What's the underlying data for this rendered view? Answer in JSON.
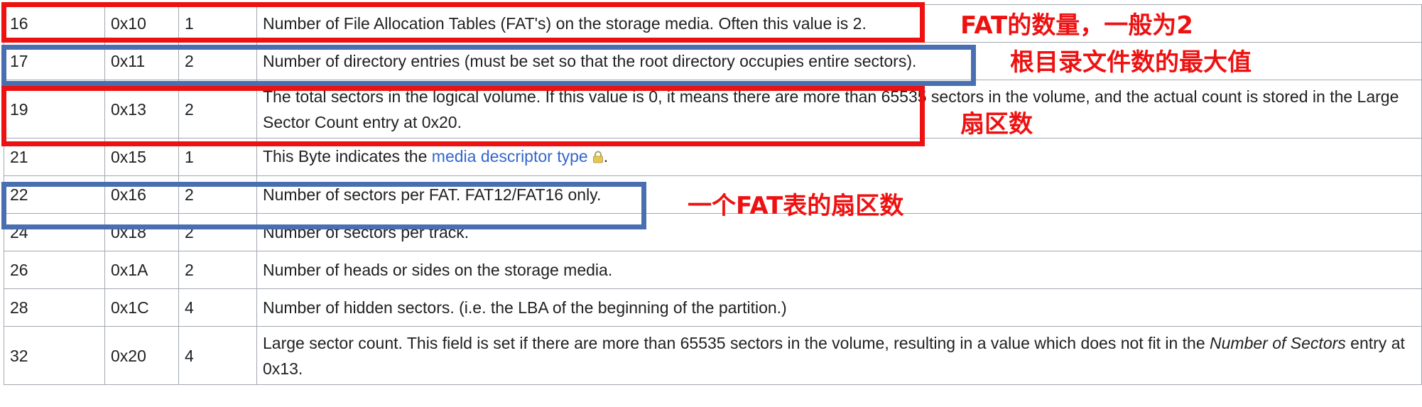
{
  "rows": [
    {
      "offset_dec": "16",
      "offset_hex": "0x10",
      "size": "1",
      "desc": "Number of File Allocation Tables (FAT's) on the storage media. Often this value is 2."
    },
    {
      "offset_dec": "17",
      "offset_hex": "0x11",
      "size": "2",
      "desc": "Number of directory entries (must be set so that the root directory occupies entire sectors)."
    },
    {
      "offset_dec": "19",
      "offset_hex": "0x13",
      "size": "2",
      "desc": "The total sectors in the logical volume. If this value is 0, it means there are more than 65535 sectors in the volume, and the actual count is stored in the Large Sector Count entry at 0x20."
    },
    {
      "offset_dec": "21",
      "offset_hex": "0x15",
      "size": "1",
      "desc_prefix": "This Byte indicates the ",
      "desc_link": "media descriptor type",
      "desc_suffix": "."
    },
    {
      "offset_dec": "22",
      "offset_hex": "0x16",
      "size": "2",
      "desc": "Number of sectors per FAT. FAT12/FAT16 only."
    },
    {
      "offset_dec": "24",
      "offset_hex": "0x18",
      "size": "2",
      "desc": "Number of sectors per track."
    },
    {
      "offset_dec": "26",
      "offset_hex": "0x1A",
      "size": "2",
      "desc": "Number of heads or sides on the storage media."
    },
    {
      "offset_dec": "28",
      "offset_hex": "0x1C",
      "size": "4",
      "desc": "Number of hidden sectors. (i.e. the LBA of the beginning of the partition.)"
    },
    {
      "offset_dec": "32",
      "offset_hex": "0x20",
      "size": "4",
      "desc_prefix": "Large sector count. This field is set if there are more than 65535 sectors in the volume, resulting in a value which does not fit in the ",
      "desc_italic": "Number of Sectors",
      "desc_suffix": " entry at 0x13."
    }
  ],
  "annotations": {
    "fat_count": "FAT的数量，一般为2",
    "root_entries": "根目录文件数的最大值",
    "sector_count": "扇区数",
    "sectors_per_fat": "一个FAT表的扇区数"
  },
  "colors": {
    "red_box": "#ee1111",
    "blue_box": "#4a6fb0",
    "link": "#3366cc",
    "annotation_text": "#ee1111"
  },
  "icons": {
    "lock": "lock-icon"
  }
}
